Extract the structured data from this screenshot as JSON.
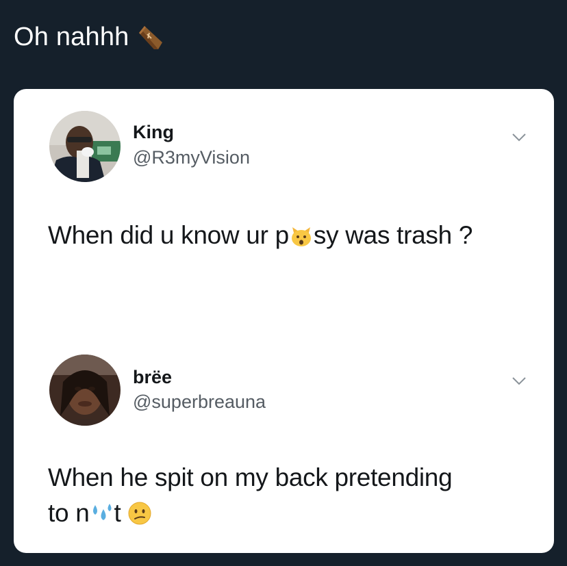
{
  "caption": {
    "text": "Oh nahhh",
    "emoji": "coffin-icon"
  },
  "tweets": [
    {
      "name": "King",
      "handle": "@R3myVision",
      "text_before": "When did u know ur p",
      "emoji": "cat-face-icon",
      "text_after": "sy was trash ?"
    },
    {
      "name": "brëe",
      "handle": "@superbreauna",
      "line1": "When he spit on my back pretending",
      "line2_before": "to n",
      "emoji_mid": "sweat-droplets-icon",
      "line2_after": "t",
      "emoji_end": "confused-face-icon"
    }
  ],
  "colors": {
    "background": "#15202b",
    "card": "#ffffff",
    "text": "#14171a",
    "handle": "#555c63"
  }
}
